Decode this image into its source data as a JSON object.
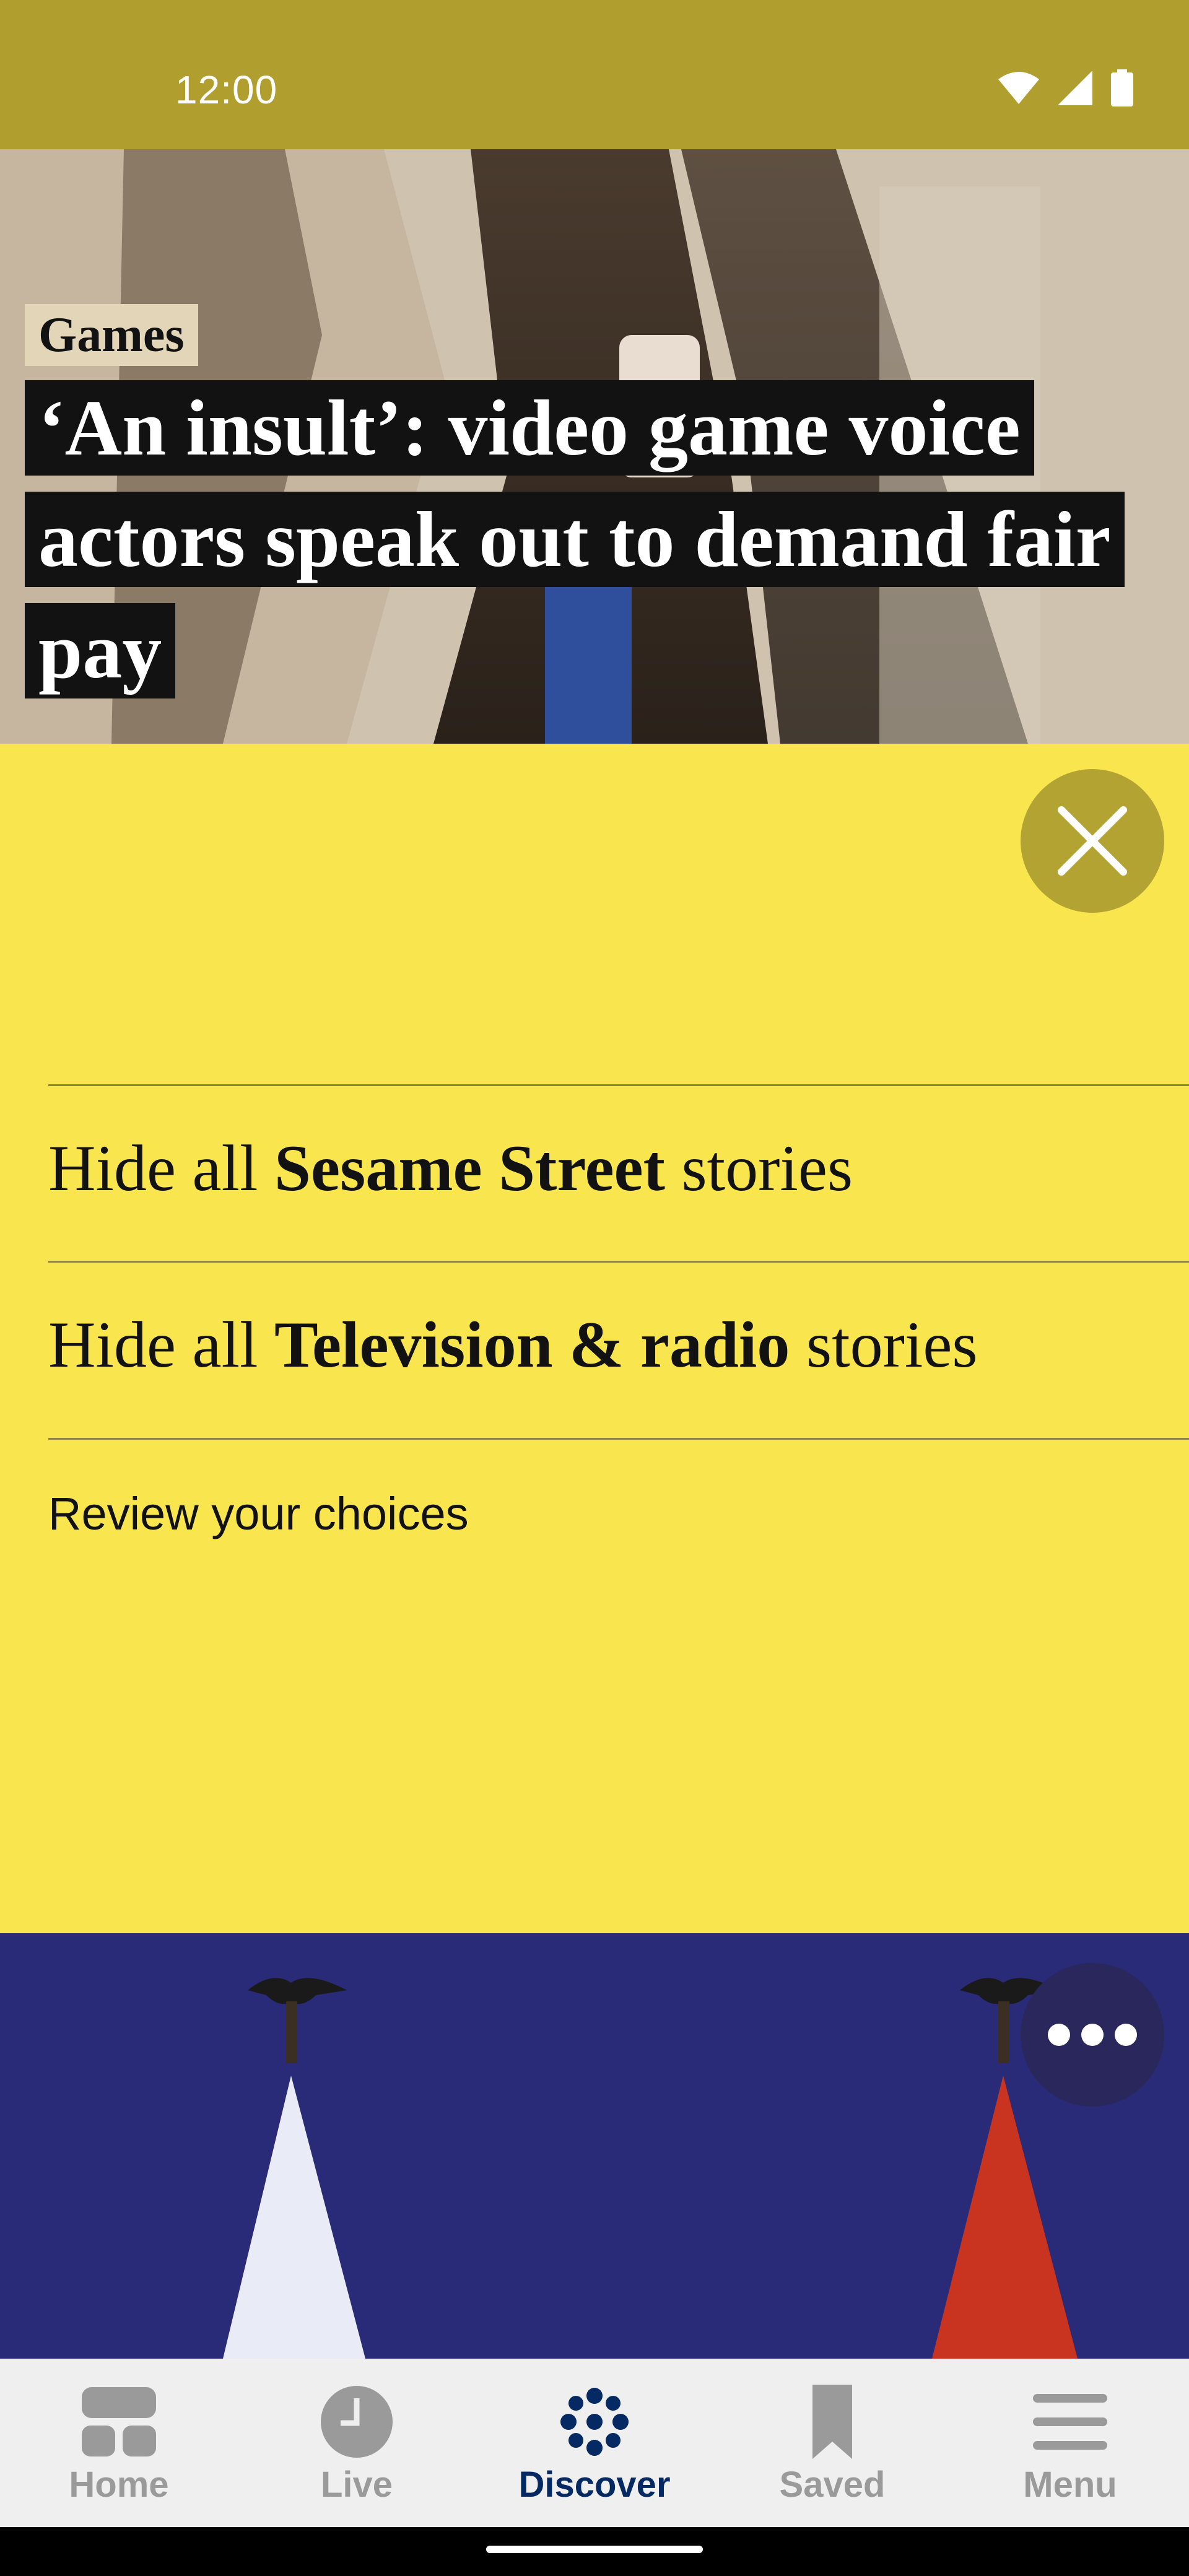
{
  "status_bar": {
    "time": "12:00",
    "background": "#B09F2F"
  },
  "hero": {
    "kicker": "Games",
    "headline": "‘An insult’: video game voice actors speak out to demand fair pay"
  },
  "panel": {
    "background": "#F9E64E",
    "close_icon": "close-icon",
    "options": [
      {
        "prefix": "Hide all ",
        "topic": "Sesame Street",
        "suffix": " stories"
      },
      {
        "prefix": "Hide all ",
        "topic": "Television & radio",
        "suffix": " stories"
      }
    ],
    "review_label": "Review your choices"
  },
  "photo": {
    "more_icon": "more-options-icon"
  },
  "bottom_nav": {
    "items": [
      {
        "label": "Home",
        "icon": "home-icon",
        "active": false
      },
      {
        "label": "Live",
        "icon": "clock-icon",
        "active": false
      },
      {
        "label": "Discover",
        "icon": "discover-icon",
        "active": true
      },
      {
        "label": "Saved",
        "icon": "bookmark-icon",
        "active": false
      },
      {
        "label": "Menu",
        "icon": "menu-icon",
        "active": false
      }
    ],
    "active_color": "#052962",
    "inactive_color": "#9a9a9a"
  }
}
